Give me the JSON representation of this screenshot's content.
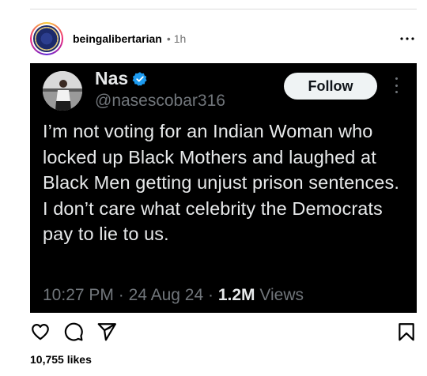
{
  "post": {
    "username": "beingalibertarian",
    "separator": "•",
    "time": "1h",
    "more_icon": "more-horizontal-icon"
  },
  "tweet": {
    "name": "Nas",
    "handle": "@nasescobar316",
    "follow_label": "Follow",
    "text": "I’m not voting for an Indian Woman who locked up Black Mothers and laughed at Black Men getting unjust prison sentences. I don’t care what celebrity the Democrats pay to lie to us.",
    "time": "10:27 PM",
    "meta_sep": "·",
    "date": "24 Aug 24",
    "views_count": "1.2M",
    "views_label": "Views",
    "verified_color": "#1d9bf0"
  },
  "actions": {
    "like_icon": "heart-icon",
    "comment_icon": "comment-icon",
    "share_icon": "share-icon",
    "save_icon": "bookmark-icon"
  },
  "likes": {
    "count": "10,755",
    "label": "likes"
  },
  "colors": {
    "card_bg": "#000000",
    "muted": "#737373",
    "twitter_muted": "#71767b"
  }
}
